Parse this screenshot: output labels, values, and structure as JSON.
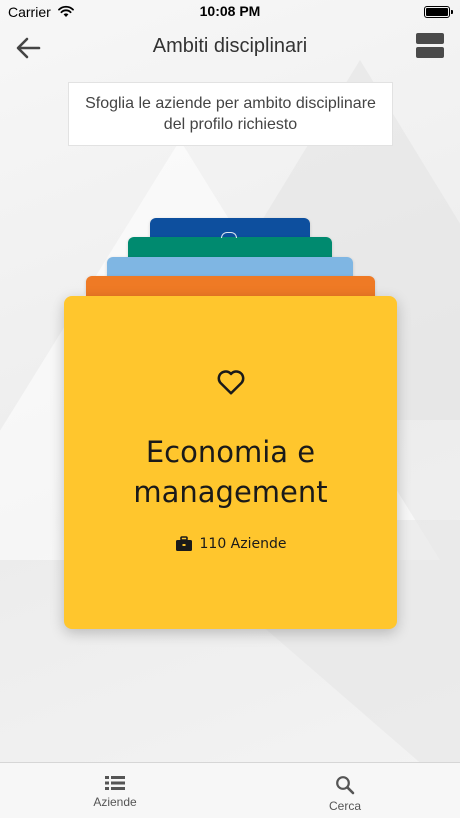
{
  "status_bar": {
    "carrier": "Carrier",
    "time": "10:08 PM"
  },
  "header": {
    "title": "Ambiti disciplinari",
    "back_icon": "arrow-left-icon",
    "view_toggle_icon": "view-agenda-icon"
  },
  "description": "Sfoglia le aziende per ambito disciplinare del profilo richiesto",
  "stack": {
    "colors": [
      "#0d4f9e",
      "#008a6f",
      "#7fb6e3",
      "#ef7a25"
    ]
  },
  "card": {
    "color": "#ffc62d",
    "icon": "heart-icon",
    "title": "Economia e management",
    "count_icon": "briefcase-icon",
    "count_label": "110 Aziende"
  },
  "tabs": [
    {
      "label": "Aziende",
      "icon": "list-icon"
    },
    {
      "label": "Cerca",
      "icon": "search-icon"
    }
  ]
}
